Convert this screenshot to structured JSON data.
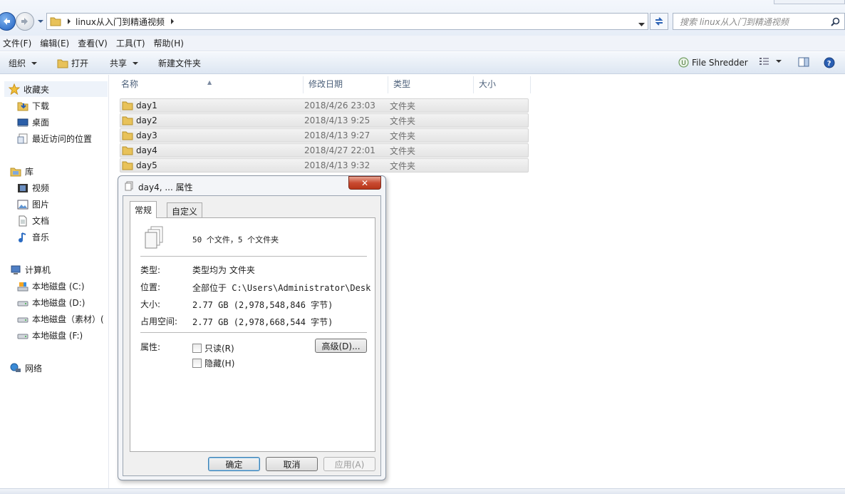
{
  "address": {
    "path": "linux从入门到精通视频",
    "search_placeholder": "搜索 linux从入门到精通视频"
  },
  "menu": [
    "文件(F)",
    "编辑(E)",
    "查看(V)",
    "工具(T)",
    "帮助(H)"
  ],
  "toolbar": {
    "organize": "组织",
    "open": "打开",
    "share": "共享",
    "new_folder": "新建文件夹",
    "shredder": "File Shredder"
  },
  "nav": {
    "favorites": "收藏夹",
    "downloads": "下载",
    "desktop": "桌面",
    "recent": "最近访问的位置",
    "libraries": "库",
    "videos": "视频",
    "pictures": "图片",
    "documents": "文档",
    "music": "音乐",
    "computer": "计算机",
    "drive_c": "本地磁盘 (C:)",
    "drive_d": "本地磁盘 (D:)",
    "drive_e": "本地磁盘（素材）(",
    "drive_f": "本地磁盘 (F:)",
    "network": "网络"
  },
  "columns": {
    "name": "名称",
    "modified": "修改日期",
    "type": "类型",
    "size": "大小"
  },
  "files": [
    {
      "name": "day1",
      "date": "2018/4/26 23:03",
      "type": "文件夹"
    },
    {
      "name": "day2",
      "date": "2018/4/13 9:25",
      "type": "文件夹"
    },
    {
      "name": "day3",
      "date": "2018/4/13 9:27",
      "type": "文件夹"
    },
    {
      "name": "day4",
      "date": "2018/4/27 22:01",
      "type": "文件夹"
    },
    {
      "name": "day5",
      "date": "2018/4/13 9:32",
      "type": "文件夹"
    }
  ],
  "dialog": {
    "title": "day4, ... 属性",
    "close": "✕",
    "tab_general": "常规",
    "tab_custom": "自定义",
    "summary": "50 个文件，5 个文件夹",
    "type_label": "类型:",
    "type_value": "类型均为 文件夹",
    "location_label": "位置:",
    "location_value": "全部位于 C:\\Users\\Administrator\\Desktop\\l",
    "size_label": "大小:",
    "size_value": "2.77 GB (2,978,548,846 字节)",
    "disk_label": "占用空间:",
    "disk_value": "2.77 GB (2,978,668,544 字节)",
    "attr_label": "属性:",
    "readonly": "只读(R)",
    "hidden": "隐藏(H)",
    "advanced": "高级(D)...",
    "ok": "确定",
    "cancel": "取消",
    "apply": "应用(A)"
  }
}
